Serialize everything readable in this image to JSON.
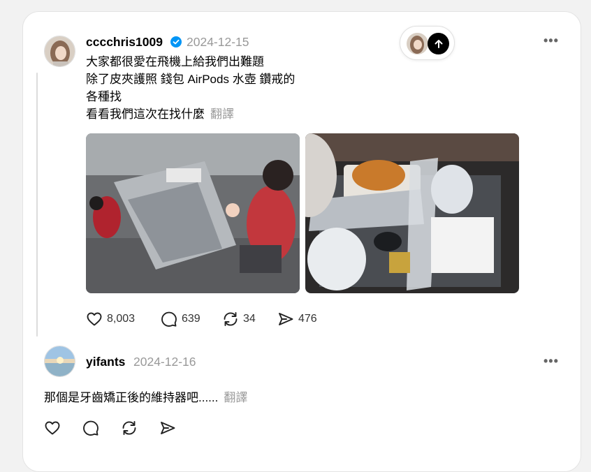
{
  "post": {
    "username": "cccchris1009",
    "timestamp": "2024-12-15",
    "lines": [
      "大家都很愛在飛機上給我們出難題",
      "除了皮夾護照 錢包 AirPods 水壺 鑽戒的",
      "各種找",
      "看看我們這次在找什麼"
    ],
    "translate_label": "翻譯",
    "likes": "8,003",
    "comments": "639",
    "reposts": "34",
    "shares": "476"
  },
  "reply": {
    "username": "yifants",
    "timestamp": "2024-12-16",
    "text": "那個是牙齒矯正後的維持器吧......",
    "translate_label": "翻譯"
  },
  "colors": {
    "verified": "#0095f6",
    "muted": "#999999",
    "line": "#dcdcdc"
  }
}
